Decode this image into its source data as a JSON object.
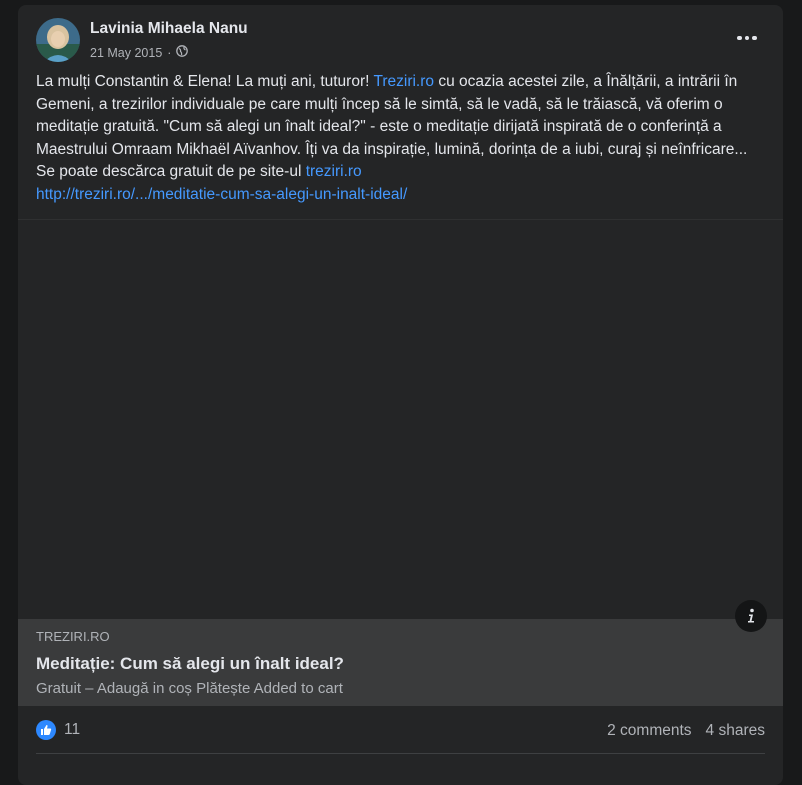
{
  "post": {
    "author": "Lavinia Mihaela Nanu",
    "date": "21 May 2015",
    "separator": "·",
    "privacy_icon": "globe-icon",
    "more_icon": "more-options-icon",
    "text_1": "La mulți Constantin & Elena! La muți ani, tuturor! ",
    "text_link_1": "Treziri.ro",
    "text_2": " cu ocazia acestei zile, a Înălțării, a intrării în Gemeni, a trezirilor individuale pe care mulți încep să le simtă, să le vadă, să le trăiască, vă oferim o meditație gratuită. \"Cum să alegi un înalt ideal?\" - este o meditație dirijată inspirată de o conferință a Maestrului Omraam Mikhaël Aïvanhov. Îți va da inspirație, lumină, dorința de a iubi, curaj și neînfricare... Se poate descărca gratuit de pe site-ul ",
    "text_link_2": "treziri.ro",
    "text_link_3": "http://treziri.ro/.../meditatie-cum-sa-alegi-un-inalt-ideal/"
  },
  "link_preview": {
    "domain": "TREZIRI.RO",
    "title": "Meditație: Cum să alegi un înalt ideal?",
    "description": "Gratuit – Adaugă in coș Plătește Added to cart",
    "info_icon": "info-icon"
  },
  "stats": {
    "reaction_icon": "like-icon",
    "reactions": "11",
    "comments": "2 comments",
    "shares": "4 shares"
  },
  "colors": {
    "background": "#18191a",
    "card": "#242526",
    "link": "#4599ff",
    "preview_bg": "#3a3b3c",
    "like_blue": "#2d88ff"
  }
}
